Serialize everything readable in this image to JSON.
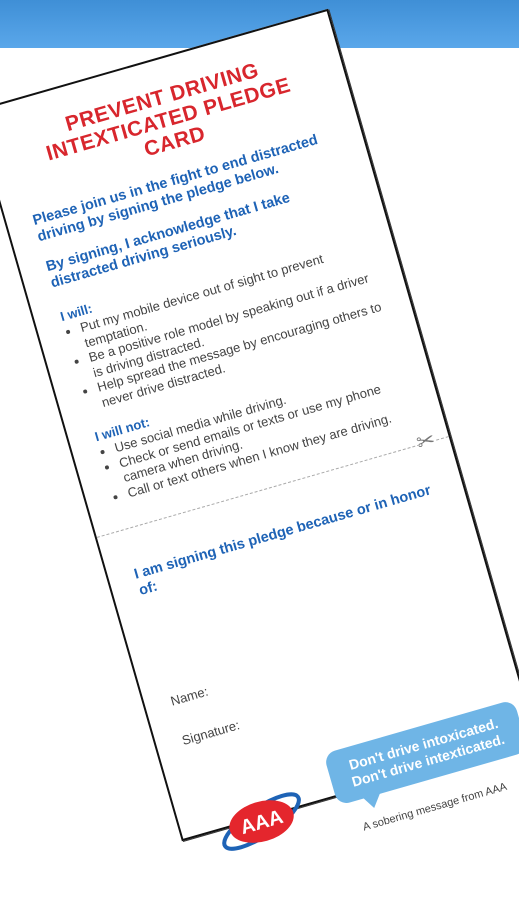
{
  "card": {
    "title": "PREVENT DRIVING INTEXTICATED PLEDGE CARD",
    "intro": "Please join us in the fight to end distracted driving by signing the pledge below.",
    "acknowledge": "By signing, I acknowledge that I take distracted driving seriously.",
    "will_heading": "I will:",
    "will_items": [
      "Put my mobile device out of sight to prevent temptation.",
      "Be a positive role model by speaking out if a driver is driving distracted.",
      "Help spread the message by encouraging others to never drive distracted."
    ],
    "will_not_heading": "I will not:",
    "will_not_items": [
      "Use social media while driving.",
      "Check or send emails or texts or use my phone camera when driving.",
      "Call or text others when I know they are driving."
    ],
    "honor": "I am signing this pledge because or in honor of:",
    "name_label": "Name:",
    "signature_label": "Signature:",
    "bubble_line1": "Don't drive intoxicated.",
    "bubble_line2": "Don't drive intexticated.",
    "sobering": "A sobering message from AAA",
    "logo_text": "AAA"
  },
  "colors": {
    "title_red": "#d8262d",
    "heading_blue": "#1e63b6",
    "bubble_blue": "#6fb5e6",
    "topbar_blue": "#4a9be0"
  },
  "icons": [
    "scissors-icon",
    "aaa-logo"
  ]
}
